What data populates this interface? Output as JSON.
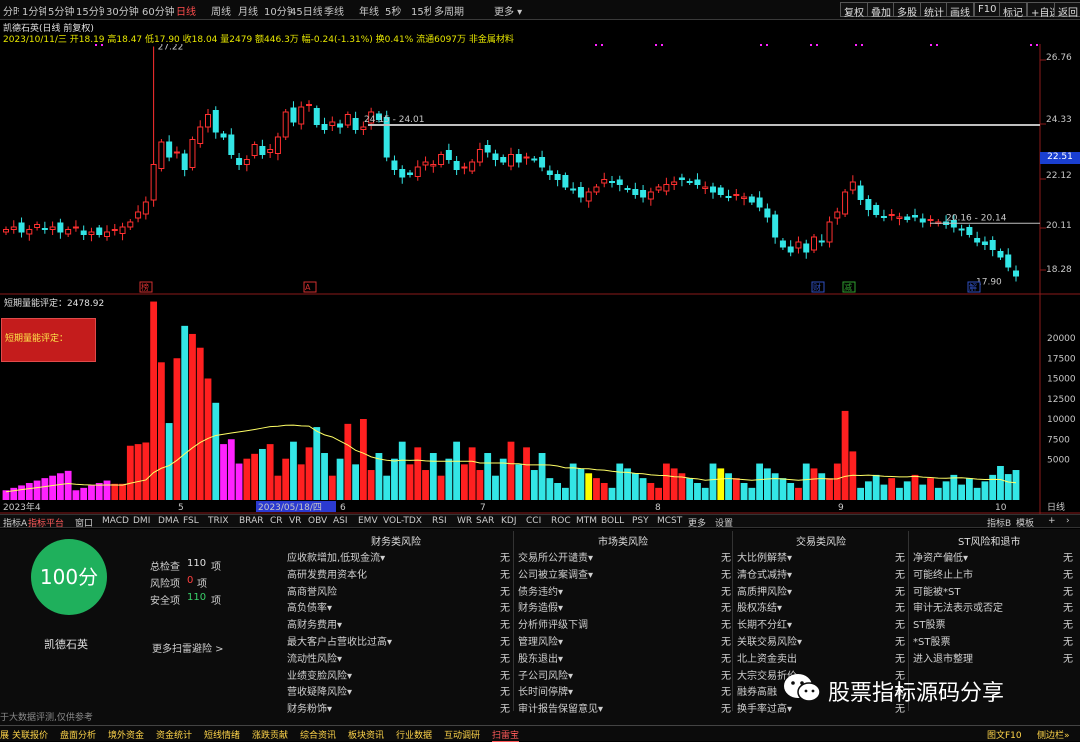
{
  "toolbar": {
    "timeframes": [
      "分时",
      "1分钟",
      "5分钟",
      "15分钟",
      "30分钟",
      "60分钟",
      "日线",
      "周线",
      "月线",
      "10分钟",
      "45日线",
      "季线",
      "年线",
      "5秒",
      "15秒",
      "多周期",
      "更多 ▾"
    ],
    "selected": "日线",
    "right_buttons": [
      "复权",
      "叠加",
      "多股",
      "统计",
      "画线",
      "F10",
      "标记",
      "+自选",
      "返回"
    ]
  },
  "stock": {
    "title": "凯德石英(日线 前复权)",
    "info_line": "2023/10/11/三 开18.19 高18.47 低17.90 收18.04 量2479 额446.3万 幅-0.24(-1.31%) 换0.41% 流通6097万 非金属材料"
  },
  "price_axis": {
    "ticks": [
      "26.76",
      "24.33",
      "22.12",
      "20.11",
      "18.28"
    ],
    "current": "22.51"
  },
  "annotations": {
    "high": "27.22",
    "low": "17.90",
    "line1": "24.15 - 24.01",
    "line2": "20.16 - 20.14"
  },
  "event_markers": [
    {
      "label": "榜",
      "color": "#d03030"
    },
    {
      "label": "A",
      "color": "#d03030"
    },
    {
      "label": "财",
      "color": "#3050c0"
    },
    {
      "label": "减",
      "color": "#30a030"
    },
    {
      "label": "解",
      "color": "#3050c0"
    }
  ],
  "volume_panel": {
    "title": "短期量能评定：2478.92",
    "box_label": "短期量能评定：",
    "ticks": [
      "20000",
      "17500",
      "15000",
      "12500",
      "10000",
      "7500",
      "5000"
    ],
    "date_labels": [
      "2023年4",
      "5",
      "2023/05/18/四",
      "6",
      "7",
      "8",
      "9",
      "10"
    ],
    "right_label": "日线"
  },
  "indicator_tabs": [
    "指标A",
    "指标平台",
    "窗口",
    "MACD",
    "DMI",
    "DMA",
    "FSL",
    "TRIX",
    "BRAR",
    "CR",
    "VR",
    "OBV",
    "ASI",
    "EMV",
    "VOL-TDX",
    "RSI",
    "WR",
    "SAR",
    "KDJ",
    "CCI",
    "ROC",
    "MTM",
    "BOLL",
    "PSY",
    "MCST",
    "更多",
    "设置"
  ],
  "indicator_selected": "指标平台",
  "indicator_right": [
    "指标B",
    "模板"
  ],
  "risk": {
    "score": "100分",
    "stock_name": "凯德石英",
    "summary": [
      {
        "label": "总检查",
        "value": "110",
        "unit": "项",
        "color": "#e0e0e0"
      },
      {
        "label": "风险项",
        "value": "0",
        "unit": "项",
        "color": "#ff4040"
      },
      {
        "label": "安全项",
        "value": "110",
        "unit": "项",
        "color": "#3ad06a"
      }
    ],
    "more_link": "更多扫雷避险 >",
    "columns": [
      {
        "title": "财务类风险",
        "items": [
          "应收款增加,低现金流▾",
          "高研发费用资本化",
          "高商誉风险",
          "高负债率▾",
          "高财务费用▾",
          "最大客户占营收比过高▾",
          "流动性风险▾",
          "业绩变脸风险▾",
          "营收疑降风险▾",
          "财务粉饰▾"
        ]
      },
      {
        "title": "市场类风险",
        "items": [
          "交易所公开谴责▾",
          "公司被立案调查▾",
          "债务违约▾",
          "财务造假▾",
          "分析师评级下调",
          "管理风险▾",
          "股东退出▾",
          "子公司风险▾",
          "长时间停牌▾",
          "审计报告保留意见▾"
        ]
      },
      {
        "title": "交易类风险",
        "items": [
          "大比例解禁▾",
          "清仓式减持▾",
          "高质押风险▾",
          "股权冻结▾",
          "长期不分红▾",
          "关联交易风险▾",
          "北上资金卖出",
          "大宗交易折价",
          "融券高融",
          "换手率过高▾"
        ]
      },
      {
        "title": "ST风险和退市",
        "items": [
          "净资产偏低▾",
          "可能终止上市",
          "可能被*ST",
          "审计无法表示或否定",
          "ST股票",
          "*ST股票",
          "进入退市整理"
        ]
      }
    ],
    "none_label": "无",
    "disclaimer": "于大数据评测,仅供参考",
    "watermark": "股票指标源码分享"
  },
  "bottom_tabs": [
    "展",
    "关联报价",
    "盘面分析",
    "境外资金",
    "资金统计",
    "短线情绪",
    "涨跌贡献",
    "综合资讯",
    "板块资讯",
    "行业数据",
    "互动调研",
    "扫雷宝"
  ],
  "bottom_selected": "扫雷宝",
  "bottom_right": [
    "图文F10",
    "侧边栏»"
  ],
  "colors": {
    "up": "#ff3030",
    "down": "#33e6e6",
    "accent": "#ff4d4d",
    "magenta": "#ff22ff",
    "yellow": "#ffff00"
  }
}
